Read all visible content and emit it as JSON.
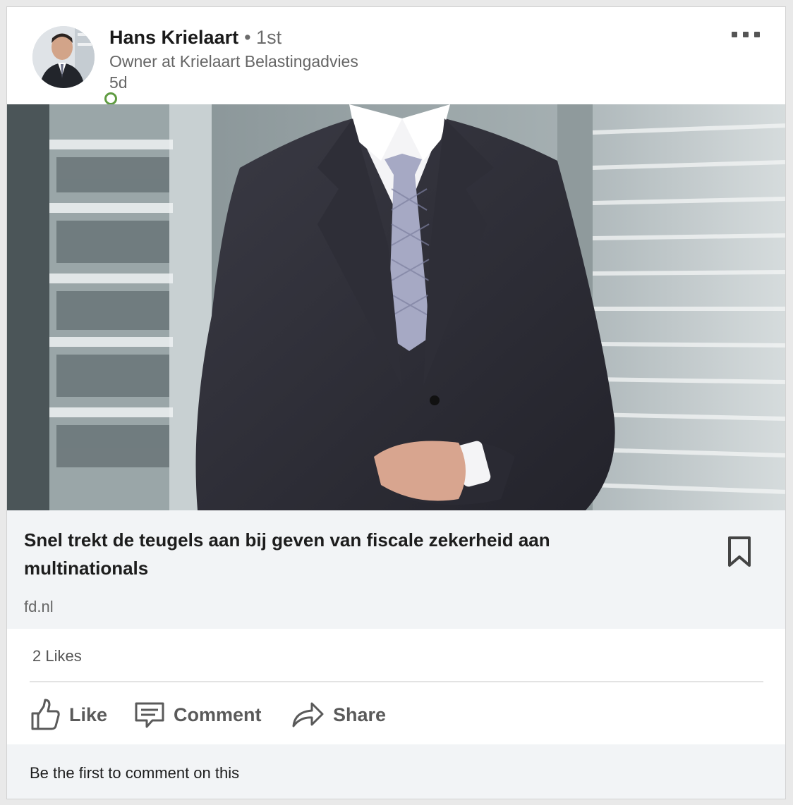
{
  "post": {
    "author": {
      "name": "Hans Krielaart",
      "degree": "• 1st",
      "headline": "Owner at Krielaart Belastingadvies",
      "time": "5d",
      "presence_color": "#5f9b41"
    },
    "more_icon": "ellipsis-icon",
    "article": {
      "title": "Snel trekt de teugels aan bij geven van fiscale zekerheid aan multinationals",
      "source": "fd.nl",
      "bookmark_icon": "bookmark-icon"
    },
    "social": {
      "likes": "2 Likes"
    },
    "actions": {
      "like": "Like",
      "comment": "Comment",
      "share": "Share"
    },
    "comment_prompt": "Be the first to comment on this"
  }
}
